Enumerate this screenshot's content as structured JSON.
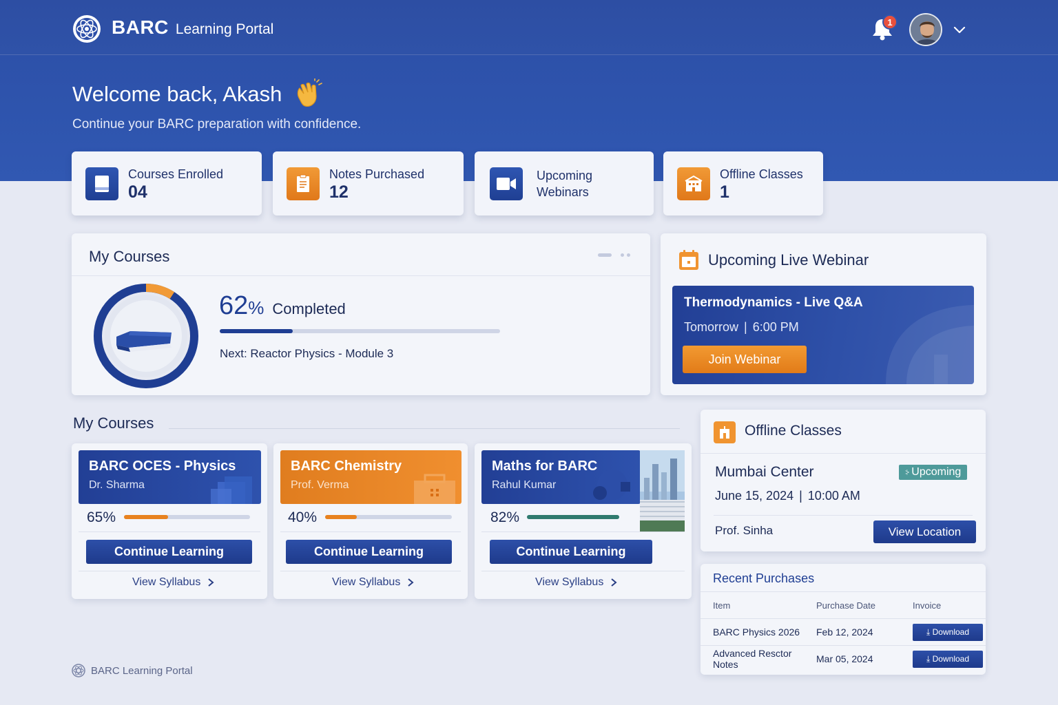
{
  "header": {
    "brand_strong": "BARC",
    "brand_light": "Learning Portal",
    "notification_count": "1"
  },
  "hero": {
    "welcome": "Welcome back, Akash",
    "subtitle": "Continue your BARC preparation with confidence."
  },
  "stats": [
    {
      "label": "Courses Enrolled",
      "value": "04",
      "icon": "book-icon"
    },
    {
      "label": "Notes Purchased",
      "value": "12",
      "icon": "notes-icon"
    },
    {
      "label": "Upcoming",
      "label2": "Webinars",
      "icon": "video-icon"
    },
    {
      "label": "Offline Classes",
      "value": "1",
      "icon": "building-icon"
    }
  ],
  "progress": {
    "title": "My Courses",
    "percent": "62",
    "percent_sign": "%",
    "completed_label": "Completed",
    "next": "Next: Reactor Physics - Module 3",
    "value": 0.26
  },
  "webinar": {
    "title": "Upcoming Live Webinar",
    "session": "Thermodynamics - Live Q&A",
    "day": "Tomorrow",
    "time": "6:00 PM",
    "join_label": "Join Webinar"
  },
  "courses_section": {
    "title": "My Courses",
    "courses": [
      {
        "title": "BARC OCES - Physics",
        "instructor": "Dr. Sharma",
        "progress": "65%",
        "progress_value": 0.35,
        "button": "Continue Learning",
        "syllabus": "View Syllabus",
        "color": "#e8821f"
      },
      {
        "title": "BARC Chemistry",
        "instructor": "Prof. Verma",
        "progress": "40%",
        "progress_value": 0.25,
        "button": "Continue Learning",
        "syllabus": "View Syllabus",
        "color": "#e8821f"
      },
      {
        "title": "Maths for BARC",
        "instructor": "Rahul Kumar",
        "progress": "82%",
        "progress_value": 1.0,
        "button": "Continue Learning",
        "syllabus": "View Syllabus",
        "color": "#2f7a6e"
      }
    ]
  },
  "offline": {
    "title": "Offline Classes",
    "center": "Mumbai Center",
    "status": "Upcoming",
    "date": "June 15, 2024",
    "time": "10:00 AM",
    "instructor": "Prof. Sinha",
    "location_label": "View Location"
  },
  "purchases": {
    "title": "Recent Purchases",
    "columns": [
      "Item",
      "Purchase Date",
      "Invoice"
    ],
    "rows": [
      {
        "item": "BARC Physics 2026",
        "date": "Feb 12, 2024",
        "action": "Download"
      },
      {
        "item": "Advanced Resctor Notes",
        "date": "Mar 05, 2024",
        "action": "Download"
      }
    ]
  },
  "footer": {
    "label": "BARC Learning Portal"
  },
  "colors": {
    "primary": "#2d4fa8",
    "accent": "#e8821f",
    "success": "#2f7a6e"
  }
}
